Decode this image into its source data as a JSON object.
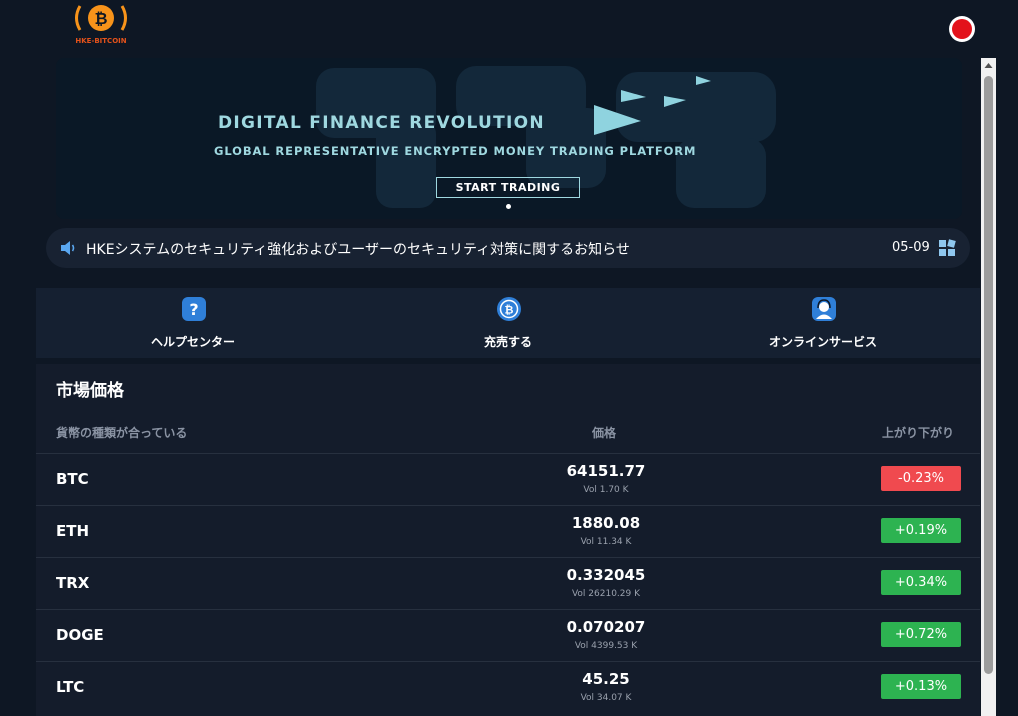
{
  "header": {
    "logo_text": "HKE-BITCOIN",
    "brand_color": "#f7931a"
  },
  "banner": {
    "headline": "DIGITAL FINANCE REVOLUTION",
    "subline": "GLOBAL REPRESENTATIVE ENCRYPTED MONEY TRADING PLATFORM",
    "cta": "START TRADING"
  },
  "notice": {
    "icon": "speaker-icon",
    "text": "HKEシステムのセキュリティ強化およびユーザーのセキュリティ対策に関するお知らせ",
    "date": "05-09",
    "more_icon": "grid-icon"
  },
  "quick_nav": [
    {
      "icon": "help-icon",
      "label": "ヘルプセンター"
    },
    {
      "icon": "coin-icon",
      "label": "充売する"
    },
    {
      "icon": "support-agent-icon",
      "label": "オンラインサービス"
    }
  ],
  "market": {
    "title": "市場価格",
    "columns": {
      "pair": "貨幣の種類が合っている",
      "price": "価格",
      "change": "上がり下がり"
    },
    "rows": [
      {
        "symbol": "BTC",
        "price": "64151.77",
        "volume": "Vol 1.70 K",
        "change": "-0.23%",
        "direction": "down"
      },
      {
        "symbol": "ETH",
        "price": "1880.08",
        "volume": "Vol 11.34 K",
        "change": "+0.19%",
        "direction": "up"
      },
      {
        "symbol": "TRX",
        "price": "0.332045",
        "volume": "Vol 26210.29 K",
        "change": "+0.34%",
        "direction": "up"
      },
      {
        "symbol": "DOGE",
        "price": "0.070207",
        "volume": "Vol 4399.53 K",
        "change": "+0.72%",
        "direction": "up"
      },
      {
        "symbol": "LTC",
        "price": "45.25",
        "volume": "Vol 34.07 K",
        "change": "+0.13%",
        "direction": "up"
      }
    ]
  },
  "colors": {
    "up": "#2db351",
    "down": "#f04a4f",
    "accent": "#9fd8e0",
    "icon_blue": "#2f7fd8"
  }
}
